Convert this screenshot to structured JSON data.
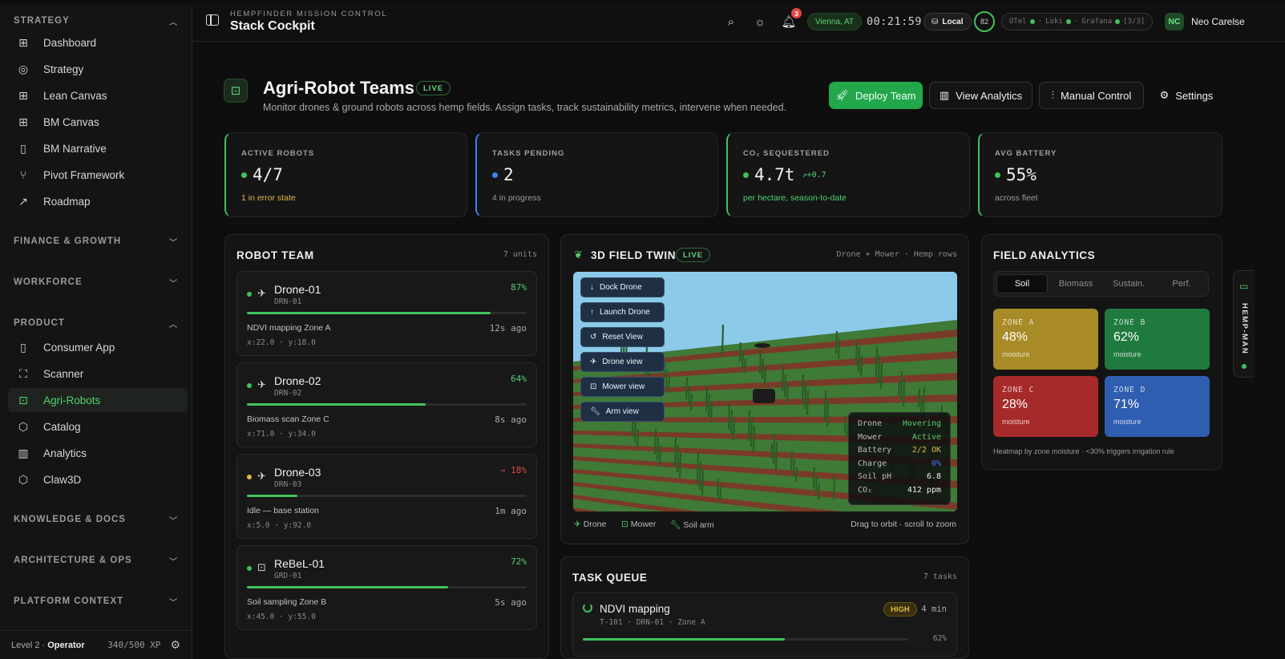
{
  "sidebar": {
    "sections": [
      {
        "label": "STRATEGY",
        "expanded": true
      },
      {
        "label": "FINANCE & GROWTH",
        "expanded": false
      },
      {
        "label": "WORKFORCE",
        "expanded": false
      },
      {
        "label": "PRODUCT",
        "expanded": true
      },
      {
        "label": "KNOWLEDGE & DOCS",
        "expanded": false
      },
      {
        "label": "ARCHITECTURE & OPS",
        "expanded": false
      },
      {
        "label": "PLATFORM CONTEXT",
        "expanded": false
      }
    ],
    "strategy_items": [
      {
        "label": "Dashboard",
        "icon": "grid-icon"
      },
      {
        "label": "Strategy",
        "icon": "target-icon"
      },
      {
        "label": "Lean Canvas",
        "icon": "grid-icon"
      },
      {
        "label": "BM Canvas",
        "icon": "grid-icon"
      },
      {
        "label": "BM Narrative",
        "icon": "book-icon"
      },
      {
        "label": "Pivot Framework",
        "icon": "branch-icon"
      },
      {
        "label": "Roadmap",
        "icon": "trend-icon"
      }
    ],
    "product_items": [
      {
        "label": "Consumer App",
        "icon": "phone-icon"
      },
      {
        "label": "Scanner",
        "icon": "scan-icon"
      },
      {
        "label": "Agri-Robots",
        "icon": "robot-icon",
        "active": true
      },
      {
        "label": "Catalog",
        "icon": "box-icon"
      },
      {
        "label": "Analytics",
        "icon": "bar-chart-icon"
      },
      {
        "label": "Claw3D",
        "icon": "cube-icon"
      }
    ],
    "footer": {
      "level_prefix": "Level 2 ·",
      "level_name": "Operator",
      "xp": "340/500 XP"
    }
  },
  "topbar": {
    "kicker": "HEMPFINDER MISSION CONTROL",
    "title": "Stack Cockpit",
    "notifications": "3",
    "location": "Vienna, AT",
    "clock": "00:21:59",
    "storage": "Local",
    "score": "82",
    "telemetry": {
      "otel": "OTel",
      "loki": "Loki",
      "grafana": "Grafana",
      "count": "[3/3]"
    },
    "user": {
      "initials": "NC",
      "name": "Neo Carelse"
    }
  },
  "header": {
    "title": "Agri-Robot Teams",
    "live": "LIVE",
    "subtitle": "Monitor drones & ground robots across hemp fields. Assign tasks, track sustainability metrics, intervene when needed.",
    "buttons": {
      "deploy": "Deploy Team",
      "analytics": "View Analytics",
      "manual": "Manual Control",
      "settings": "Settings"
    }
  },
  "stats": [
    {
      "label": "ACTIVE ROBOTS",
      "value": "4/7",
      "foot": "1 in error state",
      "color": "#3fc25c",
      "foot_color": "#e0b84a"
    },
    {
      "label": "TASKS PENDING",
      "value": "2",
      "foot": "4 in progress",
      "color": "#3b82f6",
      "foot_color": "#9a9a9a"
    },
    {
      "label": "CO₂ SEQUESTERED",
      "value": "4.7t",
      "trend": "↗+0.7",
      "foot": "per hectare, season-to-date",
      "color": "#3fc25c",
      "foot_color": "#4fd26f"
    },
    {
      "label": "AVG BATTERY",
      "value": "55%",
      "foot": "across fleet",
      "color": "#3fc25c",
      "foot_color": "#9a9a9a"
    }
  ],
  "robot_team": {
    "title": "ROBOT TEAM",
    "count": "7 units",
    "robots": [
      {
        "name": "Drone-01",
        "id": "DRN-01",
        "battery": "87%",
        "level": 0.87,
        "task": "NDVI mapping Zone A",
        "ago": "12s ago",
        "coords": "x:22.0 · y:18.0",
        "status": "#3fc25c",
        "type": "drone"
      },
      {
        "name": "Drone-02",
        "id": "DRN-02",
        "battery": "64%",
        "level": 0.64,
        "task": "Biomass scan Zone C",
        "ago": "8s ago",
        "coords": "x:71.0 · y:34.0",
        "status": "#3fc25c",
        "type": "drone"
      },
      {
        "name": "Drone-03",
        "id": "DRN-03",
        "battery": "18%",
        "level": 0.18,
        "task": "Idle — base station",
        "ago": "1m ago",
        "coords": "x:5.0 · y:92.0",
        "status": "#e0b84a",
        "type": "drone",
        "low": true
      },
      {
        "name": "ReBeL-01",
        "id": "GRD-01",
        "battery": "72%",
        "level": 0.72,
        "task": "Soil sampling Zone B",
        "ago": "5s ago",
        "coords": "x:45.0 · y:55.0",
        "status": "#3fc25c",
        "type": "ground"
      }
    ]
  },
  "field_twin": {
    "title": "3D FIELD TWIN",
    "live": "LIVE",
    "meta": "Drone + Mower · Hemp rows",
    "controls": [
      "Dock Drone",
      "Launch Drone",
      "Reset View",
      "Drone view",
      "Mower view",
      "Arm view"
    ],
    "telemetry": [
      {
        "k": "Drone",
        "v": "Hovering",
        "c": "#4fd26f"
      },
      {
        "k": "Mower",
        "v": "Active",
        "c": "#4fd26f"
      },
      {
        "k": "Battery",
        "v": "2/2 OK",
        "c": "#e0b84a"
      },
      {
        "k": "Charge",
        "v": "0%",
        "c": "#3b82f6"
      },
      {
        "k": "Soil pH",
        "v": "6.8",
        "c": "#eeeeee"
      },
      {
        "k": "CO₂",
        "v": "412 ppm",
        "c": "#eeeeee"
      }
    ],
    "legend": [
      "Drone",
      "Mower",
      "Soil arm"
    ],
    "hint": "Drag to orbit · scroll to zoom"
  },
  "analytics": {
    "title": "FIELD ANALYTICS",
    "tabs": [
      "Soil",
      "Biomass",
      "Sustain.",
      "Perf."
    ],
    "zones": [
      {
        "label": "ZONE A",
        "value": "48%",
        "unit": "moisture",
        "color": "#a88b26"
      },
      {
        "label": "ZONE B",
        "value": "62%",
        "unit": "moisture",
        "color": "#1f7a3e"
      },
      {
        "label": "ZONE C",
        "value": "28%",
        "unit": "moisture",
        "color": "#a72a2a"
      },
      {
        "label": "ZONE D",
        "value": "71%",
        "unit": "moisture",
        "color": "#2f5db0"
      }
    ],
    "note": "Heatmap by zone moisture · <30% triggers irrigation rule"
  },
  "task_queue": {
    "title": "TASK QUEUE",
    "count": "7 tasks",
    "tasks": [
      {
        "name": "NDVI mapping",
        "meta": "T-101 · DRN-01 · Zone A",
        "priority": "HIGH",
        "eta": "4 min",
        "progress": "62%",
        "level": 0.62
      }
    ]
  },
  "assistant": {
    "label": "HEMP-MAN"
  }
}
